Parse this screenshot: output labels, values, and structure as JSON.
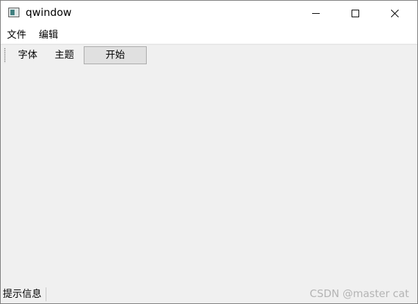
{
  "window": {
    "title": "qwindow",
    "icon": "app-window-icon",
    "controls": {
      "minimize_icon": "minimize-icon",
      "maximize_icon": "maximize-icon",
      "close_icon": "close-icon"
    }
  },
  "menubar": {
    "items": [
      {
        "label": "文件"
      },
      {
        "label": "编辑"
      }
    ]
  },
  "toolbar": {
    "buttons": [
      {
        "label": "字体"
      },
      {
        "label": "主题"
      },
      {
        "label": "开始",
        "state": "pressed"
      }
    ]
  },
  "statusbar": {
    "message": "提示信息"
  },
  "watermark": {
    "text": "CSDN @master cat"
  },
  "colors": {
    "window_bg": "#f0f0f0",
    "titlebar_bg": "#ffffff",
    "pressed_button_bg": "#e0e0e0",
    "watermark": "#b4b4b4"
  }
}
